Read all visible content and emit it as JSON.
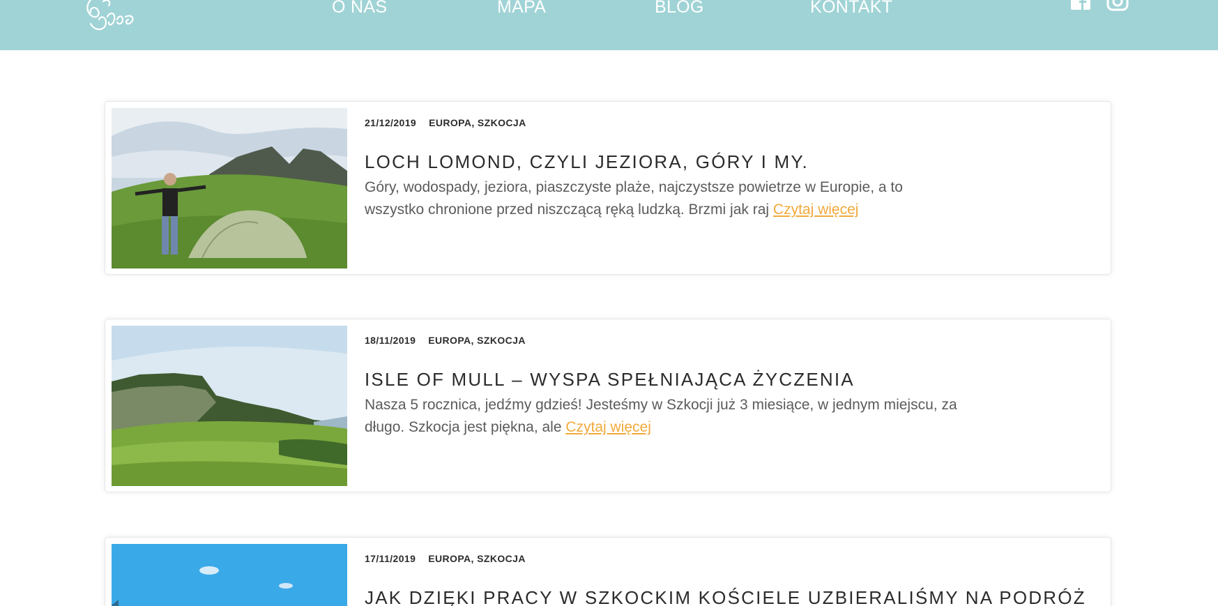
{
  "header": {
    "bg_color": "#a0d3d6",
    "nav": [
      {
        "label": "O NAS"
      },
      {
        "label": "MAPA"
      },
      {
        "label": "BLOG"
      },
      {
        "label": "KONTAKT"
      }
    ],
    "social": [
      "facebook-icon",
      "instagram-icon"
    ]
  },
  "posts": [
    {
      "date": "21/12/2019",
      "categories": "EUROPA, SZKOCJA",
      "title": "LOCH LOMOND, CZYLI JEZIORA, GÓRY I MY.",
      "excerpt": "Góry, wodospady, jeziora, piaszczyste plaże, najczystsze powietrze w Europie, a to wszystko chronione przed niszczącą ręką ludzką. Brzmi jak raj",
      "read_more": "Czytaj więcej"
    },
    {
      "date": "18/11/2019",
      "categories": "EUROPA, SZKOCJA",
      "title": "ISLE OF MULL – WYSPA SPEŁNIAJĄCA ŻYCZENIA",
      "excerpt": "Nasza 5 rocznica, jedźmy gdzieś! Jesteśmy w Szkocji już 3 miesiące, w jednym miejscu, za długo. Szkocja jest piękna, ale",
      "read_more": "Czytaj więcej"
    },
    {
      "date": "17/11/2019",
      "categories": "EUROPA, SZKOCJA",
      "title": "JAK DZIĘKI PRACY W SZKOCKIM KOŚCIELE UZBIERALIŚMY NA PODRÓŻ"
    }
  ],
  "colors": {
    "accent_link": "#f2a93b",
    "text": "#3a3a3a"
  }
}
